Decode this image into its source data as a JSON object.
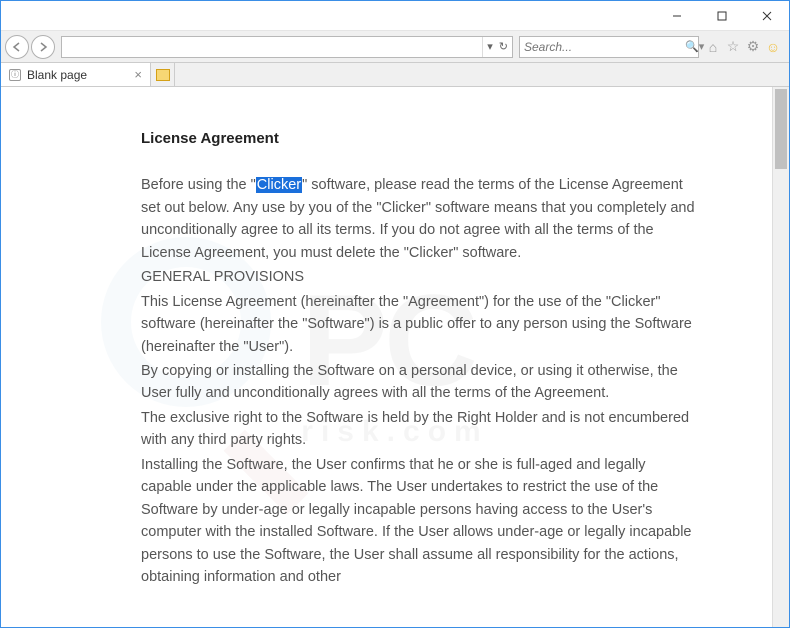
{
  "window": {
    "minimize": "—",
    "maximize": "☐",
    "close": "✕"
  },
  "nav": {
    "url_value": "",
    "refresh": "↻",
    "dropdown": "▾"
  },
  "search": {
    "placeholder": "Search...",
    "dropdown": "▾",
    "magnifier_label": "🔍"
  },
  "righticons": {
    "home": "⌂",
    "star": "☆",
    "gear": "⚙",
    "smiley": "☺"
  },
  "tab": {
    "label": "Blank page",
    "close": "×"
  },
  "doc": {
    "title": "License Agreement",
    "p1_a": "Before using the \"",
    "p1_hl": "Clicker",
    "p1_b": "\" software, please read the terms of the License Agreement set out below. Any use by you of the \"Clicker\" software means that you completely and unconditionally agree to all its terms. If you do not agree with all the terms of the License Agreement, you must delete the \"Clicker\" software.",
    "p2": "GENERAL PROVISIONS",
    "p3": "This License Agreement (hereinafter the \"Agreement\") for the use of the \"Clicker\" software (hereinafter the \"Software\") is a public offer to any person using the Software (hereinafter the \"User\").",
    "p4": "By copying or installing the Software on a personal device, or using it otherwise, the User fully and unconditionally agrees with all the terms of the Agreement.",
    "p5": "The exclusive right to the Software is held by the Right Holder and is not encumbered with any third party rights.",
    "p6": "Installing the Software, the User confirms that he or she is full-aged and legally capable under the applicable laws. The User undertakes to restrict the use of the Software by under-age or legally incapable persons having access to the User's computer with the installed Software. If the User allows under-age or legally incapable persons to use the Software, the User shall assume all responsibility for the actions, obtaining information and other"
  },
  "watermark": {
    "main": "PC",
    "sub": "risk.com"
  }
}
